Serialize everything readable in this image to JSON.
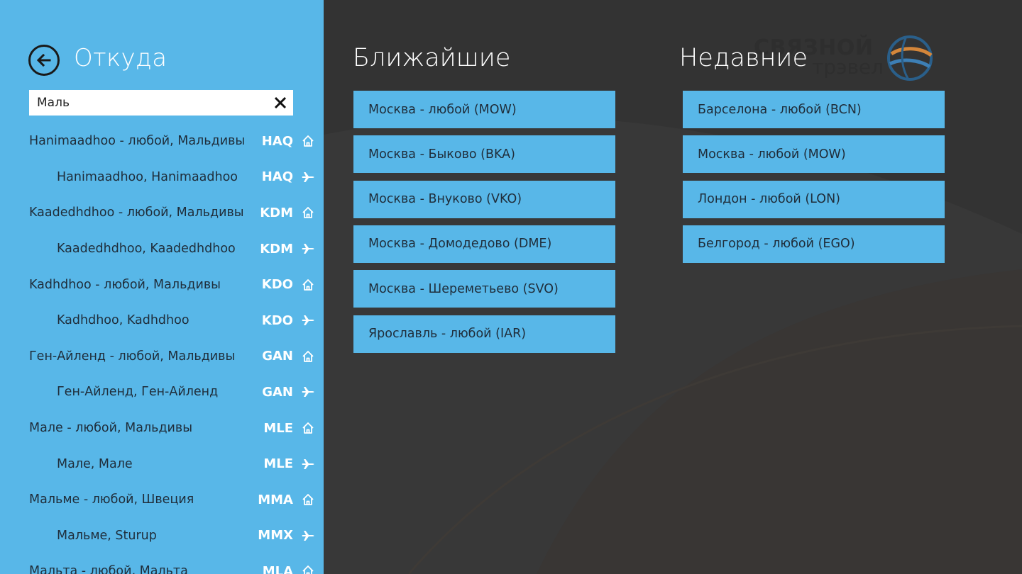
{
  "sidebar": {
    "title": "Откуда",
    "search": {
      "value": "Маль",
      "placeholder": ""
    },
    "results": [
      {
        "name": "Hanimaadhoo - любой, Мальдивы",
        "code": "HAQ",
        "icon": "home-icon",
        "child": false
      },
      {
        "name": "Hanimaadhoo, Hanimaadhoo",
        "code": "HAQ",
        "icon": "airplane-icon",
        "child": true
      },
      {
        "name": "Kaadedhdhoo - любой, Мальдивы",
        "code": "KDM",
        "icon": "home-icon",
        "child": false
      },
      {
        "name": "Kaadedhdhoo, Kaadedhdhoo",
        "code": "KDM",
        "icon": "airplane-icon",
        "child": true
      },
      {
        "name": "Kadhdhoo - любой, Мальдивы",
        "code": "KDO",
        "icon": "home-icon",
        "child": false
      },
      {
        "name": "Kadhdhoo, Kadhdhoo",
        "code": "KDO",
        "icon": "airplane-icon",
        "child": true
      },
      {
        "name": "Ген-Айленд - любой, Мальдивы",
        "code": "GAN",
        "icon": "home-icon",
        "child": false
      },
      {
        "name": "Ген-Айленд, Ген-Айленд",
        "code": "GAN",
        "icon": "airplane-icon",
        "child": true
      },
      {
        "name": "Мале - любой, Мальдивы",
        "code": "MLE",
        "icon": "home-icon",
        "child": false
      },
      {
        "name": "Мале, Мале",
        "code": "MLE",
        "icon": "airplane-icon",
        "child": true
      },
      {
        "name": "Мальме - любой, Швеция",
        "code": "MMA",
        "icon": "home-icon",
        "child": false
      },
      {
        "name": "Мальме, Sturup",
        "code": "MMX",
        "icon": "airplane-icon",
        "child": true
      },
      {
        "name": "Мальта - любой, Мальта",
        "code": "MLA",
        "icon": "home-icon",
        "child": false
      }
    ]
  },
  "nearest": {
    "title": "Ближайшие",
    "items": [
      "Москва - любой (MOW)",
      "Москва - Быково (BKA)",
      "Москва - Внуково (VKO)",
      "Москва - Домодедово (DME)",
      "Москва - Шереметьево (SVO)",
      "Ярославль - любой (IAR)"
    ]
  },
  "recent": {
    "title": "Недавние",
    "items": [
      "Барселона - любой (BCN)",
      "Москва - любой (MOW)",
      "Лондон - любой (LON)",
      "Белгород - любой (EGO)"
    ]
  },
  "logo": {
    "line1": "СВЯЗНОЙ",
    "line2": "трэвел"
  },
  "colors": {
    "accent": "#58b7e8",
    "background": "#333333",
    "text_dark": "#1f2d3a"
  }
}
